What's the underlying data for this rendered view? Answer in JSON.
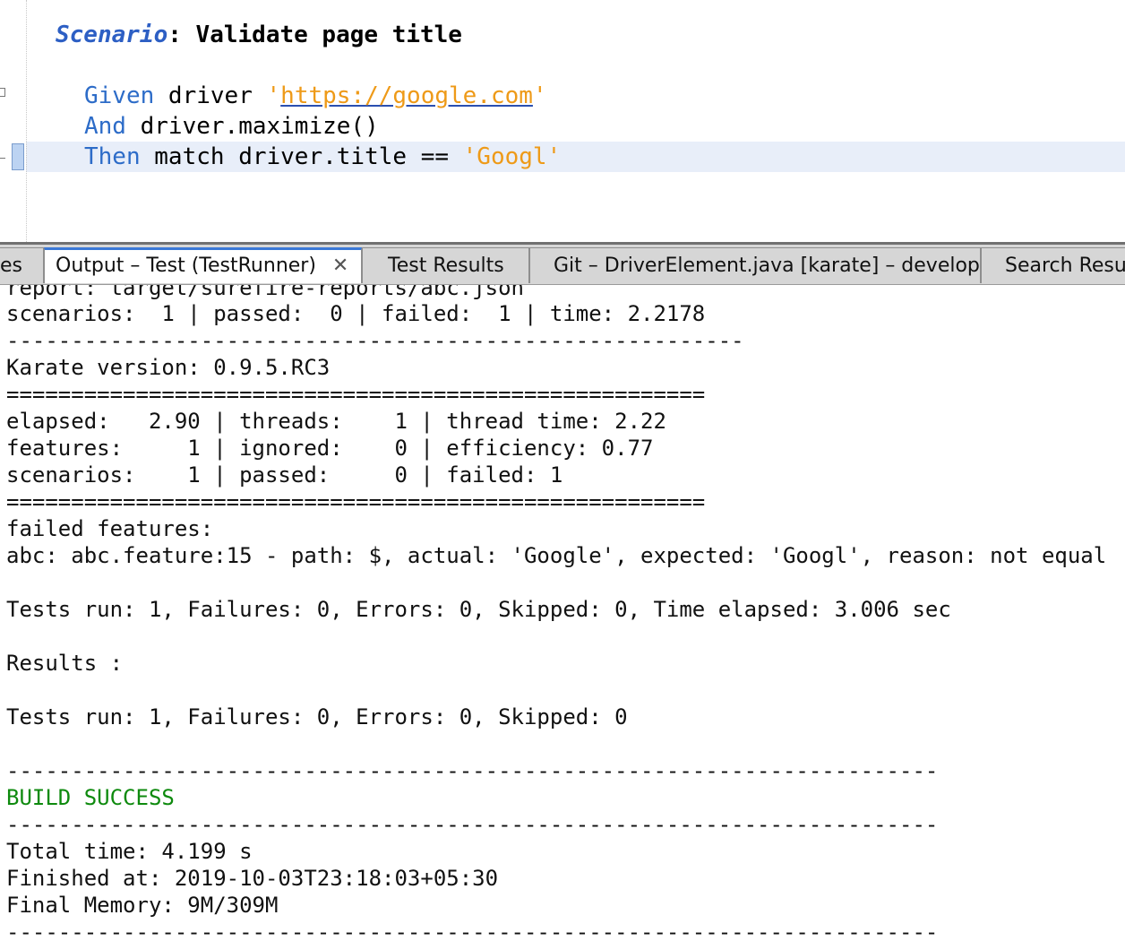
{
  "editor": {
    "scenario_keyword": "Scenario",
    "scenario_colon": ":",
    "scenario_title": "Validate page title",
    "lines": [
      {
        "keyword": "Given",
        "text": " driver ",
        "string_open": "'",
        "link": "https://google.com",
        "string_close": "'"
      },
      {
        "keyword": "And",
        "text": " driver.maximize()"
      },
      {
        "keyword": "Then",
        "text": " match driver.title == ",
        "string": "'Googl'"
      }
    ]
  },
  "tabs": [
    {
      "label": "es"
    },
    {
      "label": "Output – Test (TestRunner)",
      "close": "✕"
    },
    {
      "label": "Test Results"
    },
    {
      "label": "Git – DriverElement.java [karate] – develop"
    },
    {
      "label": "Search Resul"
    }
  ],
  "output": [
    "report: target/surefire-reports/abc.json",
    "scenarios:  1 | passed:  0 | failed:  1 | time: 2.2178",
    "---------------------------------------------------------",
    "Karate version: 0.9.5.RC3",
    "======================================================",
    "elapsed:   2.90 | threads:    1 | thread time: 2.22",
    "features:     1 | ignored:    0 | efficiency: 0.77",
    "scenarios:    1 | passed:     0 | failed: 1",
    "======================================================",
    "failed features:",
    "abc: abc.feature:15 - path: $, actual: 'Google', expected: 'Googl', reason: not equal",
    "",
    "Tests run: 1, Failures: 0, Errors: 0, Skipped: 0, Time elapsed: 3.006 sec",
    "",
    "Results :",
    "",
    "Tests run: 1, Failures: 0, Errors: 0, Skipped: 0",
    "",
    "------------------------------------------------------------------------",
    "BUILD SUCCESS",
    "------------------------------------------------------------------------",
    "Total time: 4.199 s",
    "Finished at: 2019-10-03T23:18:03+05:30",
    "Final Memory: 9M/309M",
    "------------------------------------------------------------------------"
  ],
  "colors": {
    "keyword": "#2d6cc8",
    "string": "#ee9a18",
    "build_success": "#0e8a0e",
    "active_tab_accent": "#3b78d6"
  }
}
